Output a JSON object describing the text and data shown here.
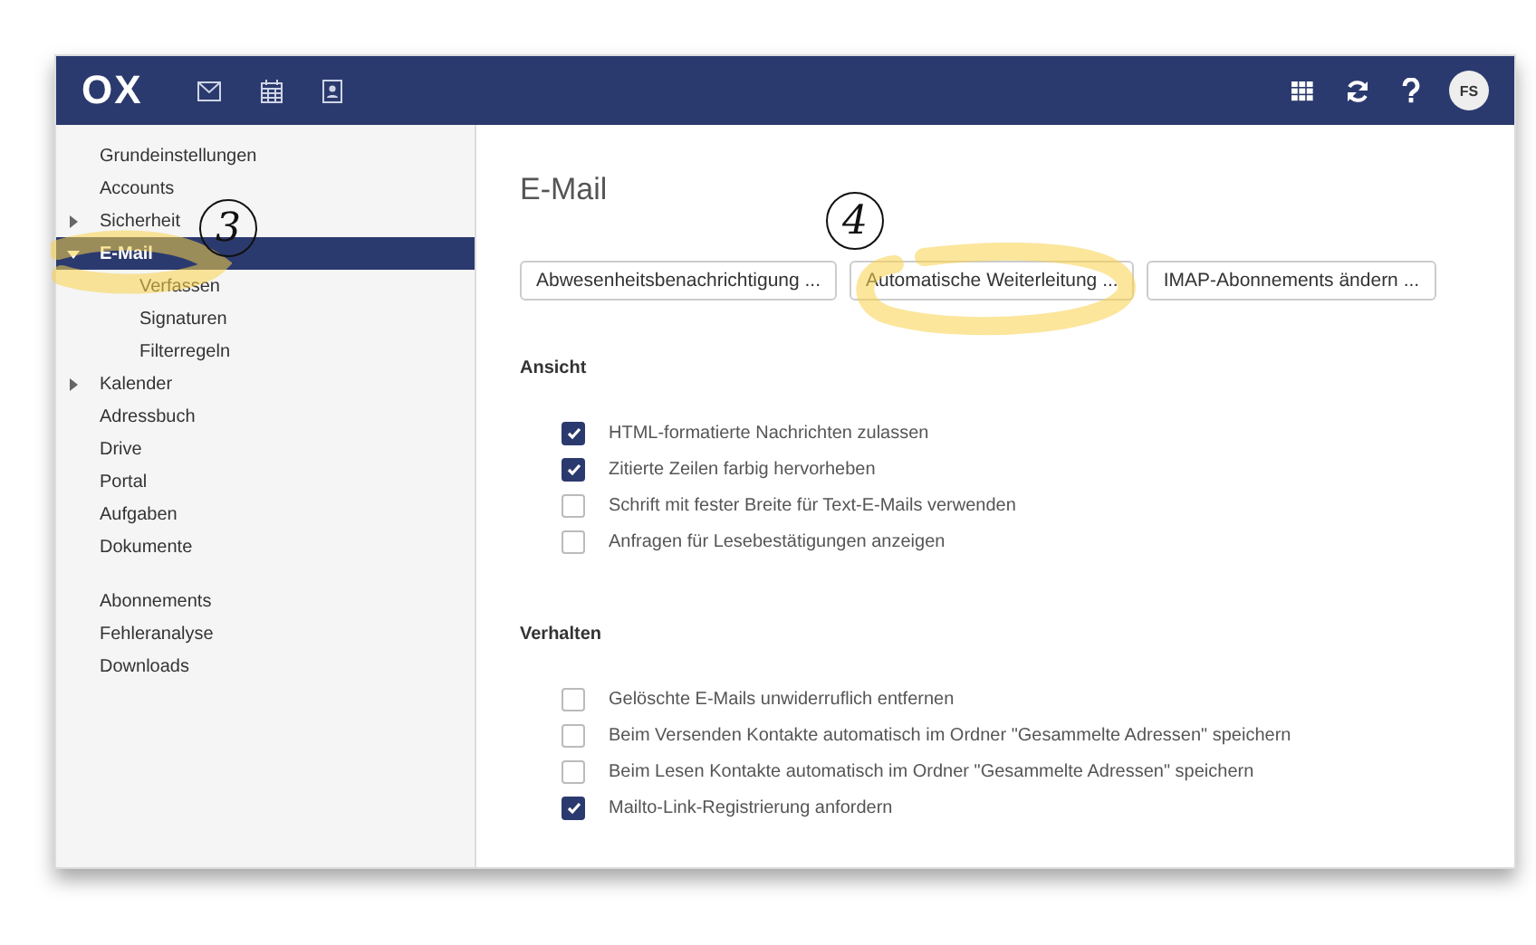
{
  "header": {
    "logo": "OX",
    "avatar": "FS"
  },
  "sidebar": {
    "groups": [
      {
        "items": [
          {
            "label": "Grundeinstellungen",
            "selected": false
          },
          {
            "label": "Accounts",
            "selected": false
          },
          {
            "label": "Sicherheit",
            "selected": false,
            "expanded": false
          },
          {
            "label": "E-Mail",
            "selected": true,
            "expanded": true,
            "children": [
              {
                "label": "Verfassen",
                "selected": false
              },
              {
                "label": "Signaturen",
                "selected": false
              },
              {
                "label": "Filterregeln",
                "selected": false
              }
            ]
          },
          {
            "label": "Kalender",
            "selected": false,
            "expanded": false
          },
          {
            "label": "Adressbuch",
            "selected": false
          },
          {
            "label": "Drive",
            "selected": false
          },
          {
            "label": "Portal",
            "selected": false
          },
          {
            "label": "Aufgaben",
            "selected": false
          },
          {
            "label": "Dokumente",
            "selected": false
          }
        ]
      },
      {
        "items": [
          {
            "label": "Abonnements",
            "selected": false
          },
          {
            "label": "Fehleranalyse",
            "selected": false
          },
          {
            "label": "Downloads",
            "selected": false
          }
        ]
      }
    ]
  },
  "content": {
    "title": "E-Mail",
    "buttons": [
      "Abwesenheitsbenachrichtigung ...",
      "Automatische Weiterleitung ...",
      "IMAP-Abonnements ändern ..."
    ],
    "sections": [
      {
        "heading": "Ansicht",
        "options": [
          {
            "label": "HTML-formatierte Nachrichten zulassen",
            "checked": true
          },
          {
            "label": "Zitierte Zeilen farbig hervorheben",
            "checked": true
          },
          {
            "label": "Schrift mit fester Breite für Text-E-Mails verwenden",
            "checked": false
          },
          {
            "label": "Anfragen für Lesebestätigungen anzeigen",
            "checked": false
          }
        ]
      },
      {
        "heading": "Verhalten",
        "options": [
          {
            "label": "Gelöschte E-Mails unwiderruflich entfernen",
            "checked": false
          },
          {
            "label": "Beim Versenden Kontakte automatisch im Ordner \"Gesammelte Adressen\" speichern",
            "checked": false
          },
          {
            "label": "Beim Lesen Kontakte automatisch im Ordner \"Gesammelte Adressen\" speichern",
            "checked": false
          },
          {
            "label": "Mailto-Link-Registrierung anfordern",
            "checked": true
          }
        ]
      }
    ]
  },
  "annotations": [
    {
      "text": "3"
    },
    {
      "text": "4"
    }
  ]
}
